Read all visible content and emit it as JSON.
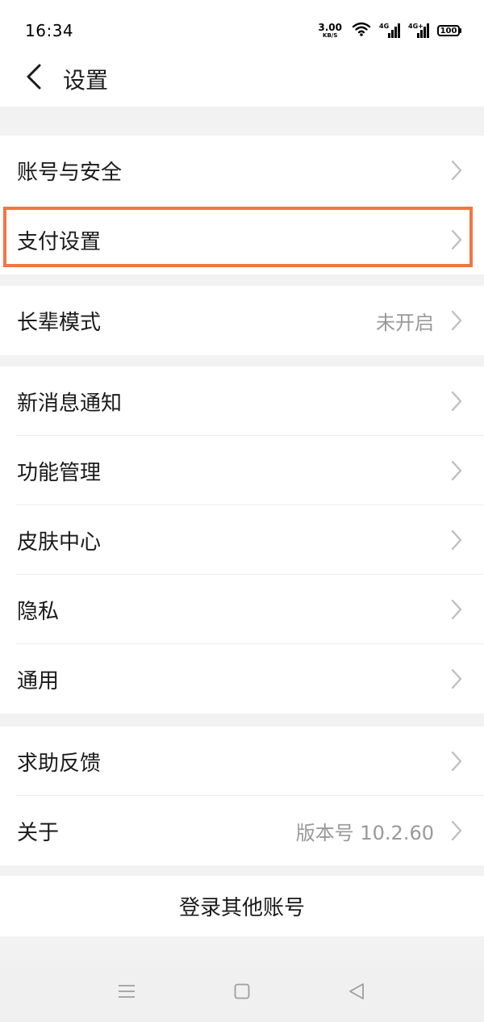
{
  "status_bar": {
    "time": "16:34",
    "net_speed": "3.00",
    "net_unit": "KB/S",
    "signal1_label": "4G",
    "signal2_label": "4G+",
    "battery": "100"
  },
  "header": {
    "title": "设置",
    "back_icon": "chevron-left-icon"
  },
  "groups": {
    "account": {
      "account_security": "账号与安全",
      "payment_settings": "支付设置"
    },
    "elder": {
      "label": "长辈模式",
      "value": "未开启"
    },
    "general": {
      "notifications": "新消息通知",
      "features": "功能管理",
      "skins": "皮肤中心",
      "privacy": "隐私",
      "general": "通用"
    },
    "support": {
      "feedback": "求助反馈",
      "about": "关于",
      "version": "版本号 10.2.60"
    }
  },
  "logout": {
    "label": "登录其他账号"
  },
  "nav": {
    "menu_icon": "menu-icon",
    "home_icon": "square-home-icon",
    "back_icon": "triangle-back-icon"
  },
  "colors": {
    "highlight": "#f27641",
    "secondary_text": "#999999",
    "background": "#f2f2f2"
  }
}
